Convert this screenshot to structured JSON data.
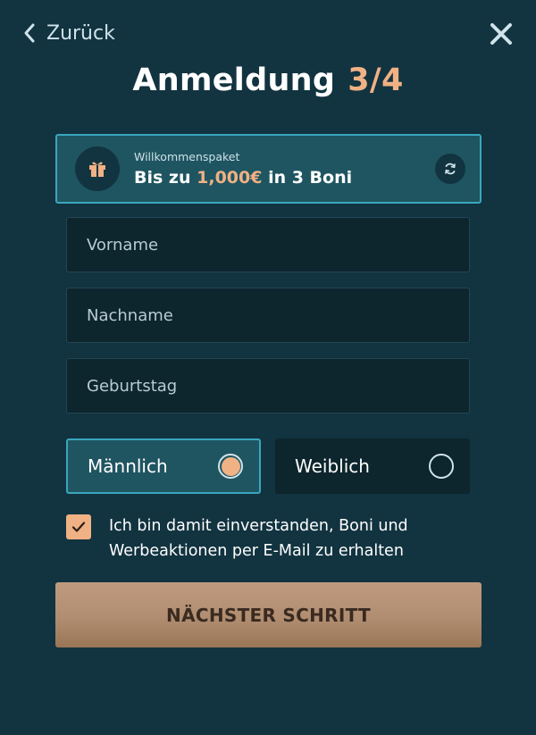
{
  "header": {
    "back_label": "Zurück",
    "title": "Anmeldung",
    "step": "3/4"
  },
  "bonus": {
    "kicker": "Willkommenspaket",
    "prefix": "Bis zu ",
    "amount": "1,000€",
    "suffix": " in 3 Boni",
    "icon": "gift-icon",
    "refresh_icon": "refresh-icon"
  },
  "form": {
    "first_name": {
      "value": "",
      "placeholder": "Vorname"
    },
    "last_name": {
      "value": "",
      "placeholder": "Nachname"
    },
    "birthday": {
      "value": "",
      "placeholder": "Geburtstag"
    }
  },
  "gender": {
    "male_label": "Männlich",
    "female_label": "Weiblich",
    "selected": "male"
  },
  "consent": {
    "checked": true,
    "text": "Ich bin damit einverstanden, Boni und Werbeaktionen per E-Mail zu erhalten"
  },
  "next_button": {
    "label": "NÄCHSTER SCHRITT"
  },
  "colors": {
    "background": "#123340",
    "accent": "#f0b184",
    "highlight_border": "#3aa6bd",
    "field_bg": "#0d252d"
  }
}
